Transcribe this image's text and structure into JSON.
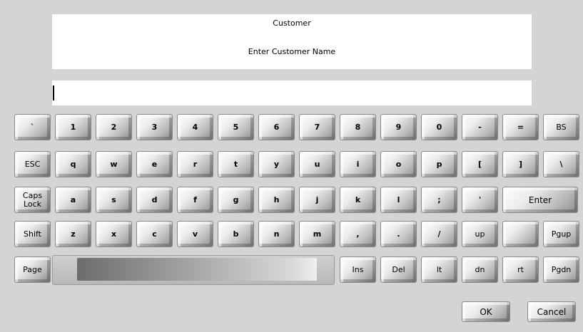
{
  "prompt": {
    "title": "Customer",
    "text": "Enter Customer Name"
  },
  "input": {
    "value": ""
  },
  "keyboard": {
    "row1": [
      "`",
      "1",
      "2",
      "3",
      "4",
      "5",
      "6",
      "7",
      "8",
      "9",
      "0",
      "-",
      "=",
      "BS"
    ],
    "row2": [
      "ESC",
      "q",
      "w",
      "e",
      "r",
      "t",
      "y",
      "u",
      "i",
      "o",
      "p",
      "[",
      "]",
      "\\"
    ],
    "row3": [
      "Caps\nLock",
      "a",
      "s",
      "d",
      "f",
      "g",
      "h",
      "j",
      "k",
      "l",
      ";",
      "'",
      "Enter"
    ],
    "row4": [
      "Shift",
      "z",
      "x",
      "c",
      "v",
      "b",
      "n",
      "m",
      ",",
      ".",
      "/",
      "up",
      "",
      "Pgup"
    ],
    "row5_left": "Page",
    "row5_right": [
      "Ins",
      "Del",
      "lt",
      "dn",
      "rt",
      "Pgdn"
    ]
  },
  "actions": {
    "ok": "OK",
    "cancel": "Cancel"
  }
}
